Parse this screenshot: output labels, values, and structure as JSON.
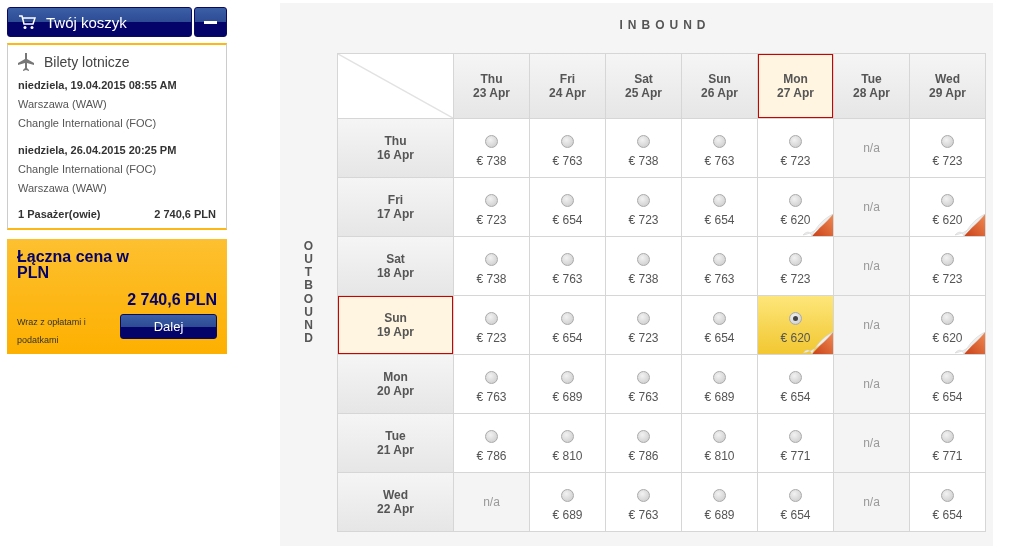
{
  "cart": {
    "title": "Twój koszyk",
    "section_title": "Bilety lotnicze",
    "flights": [
      {
        "date": "niedziela, 19.04.2015 08:55 AM",
        "from": "Warszawa (WAW)",
        "to": "Changle International (FOC)"
      },
      {
        "date": "niedziela, 26.04.2015 20:25 PM",
        "from": "Changle International (FOC)",
        "to": "Warszawa (WAW)"
      }
    ],
    "passengers": "1 Pasażer(owie)",
    "subtotal": "2 740,6 PLN"
  },
  "total": {
    "label": "Łączna cena w PLN",
    "amount": "2 740,6 PLN",
    "note": "Wraz z opłatami i podatkami",
    "button": "Dalej"
  },
  "matrix": {
    "inbound_label": "INBOUND",
    "outbound_label": "OUTBOUND",
    "columns": [
      {
        "day": "Thu",
        "date": "23 Apr",
        "selected": false
      },
      {
        "day": "Fri",
        "date": "24 Apr",
        "selected": false
      },
      {
        "day": "Sat",
        "date": "25 Apr",
        "selected": false
      },
      {
        "day": "Sun",
        "date": "26 Apr",
        "selected": false
      },
      {
        "day": "Mon",
        "date": "27 Apr",
        "selected": true
      },
      {
        "day": "Tue",
        "date": "28 Apr",
        "selected": false
      },
      {
        "day": "Wed",
        "date": "29 Apr",
        "selected": false
      }
    ],
    "rows": [
      {
        "day": "Thu",
        "date": "16 Apr",
        "selected": false,
        "cells": [
          {
            "kind": "fare",
            "price": "€ 738",
            "selected": false,
            "deal": false
          },
          {
            "kind": "fare",
            "price": "€ 763",
            "selected": false,
            "deal": false
          },
          {
            "kind": "fare",
            "price": "€ 738",
            "selected": false,
            "deal": false
          },
          {
            "kind": "fare",
            "price": "€ 763",
            "selected": false,
            "deal": false
          },
          {
            "kind": "fare",
            "price": "€ 723",
            "selected": false,
            "deal": false
          },
          {
            "kind": "na",
            "text": "n/a"
          },
          {
            "kind": "fare",
            "price": "€ 723",
            "selected": false,
            "deal": false
          }
        ]
      },
      {
        "day": "Fri",
        "date": "17 Apr",
        "selected": false,
        "cells": [
          {
            "kind": "fare",
            "price": "€ 723",
            "selected": false,
            "deal": false
          },
          {
            "kind": "fare",
            "price": "€ 654",
            "selected": false,
            "deal": false
          },
          {
            "kind": "fare",
            "price": "€ 723",
            "selected": false,
            "deal": false
          },
          {
            "kind": "fare",
            "price": "€ 654",
            "selected": false,
            "deal": false
          },
          {
            "kind": "fare",
            "price": "€ 620",
            "selected": false,
            "deal": true
          },
          {
            "kind": "na",
            "text": "n/a"
          },
          {
            "kind": "fare",
            "price": "€ 620",
            "selected": false,
            "deal": true
          }
        ]
      },
      {
        "day": "Sat",
        "date": "18 Apr",
        "selected": false,
        "cells": [
          {
            "kind": "fare",
            "price": "€ 738",
            "selected": false,
            "deal": false
          },
          {
            "kind": "fare",
            "price": "€ 763",
            "selected": false,
            "deal": false
          },
          {
            "kind": "fare",
            "price": "€ 738",
            "selected": false,
            "deal": false
          },
          {
            "kind": "fare",
            "price": "€ 763",
            "selected": false,
            "deal": false
          },
          {
            "kind": "fare",
            "price": "€ 723",
            "selected": false,
            "deal": false
          },
          {
            "kind": "na",
            "text": "n/a"
          },
          {
            "kind": "fare",
            "price": "€ 723",
            "selected": false,
            "deal": false
          }
        ]
      },
      {
        "day": "Sun",
        "date": "19 Apr",
        "selected": true,
        "cells": [
          {
            "kind": "fare",
            "price": "€ 723",
            "selected": false,
            "deal": false
          },
          {
            "kind": "fare",
            "price": "€ 654",
            "selected": false,
            "deal": false
          },
          {
            "kind": "fare",
            "price": "€ 723",
            "selected": false,
            "deal": false
          },
          {
            "kind": "fare",
            "price": "€ 654",
            "selected": false,
            "deal": false
          },
          {
            "kind": "fare",
            "price": "€ 620",
            "selected": true,
            "deal": true
          },
          {
            "kind": "na",
            "text": "n/a"
          },
          {
            "kind": "fare",
            "price": "€ 620",
            "selected": false,
            "deal": true
          }
        ]
      },
      {
        "day": "Mon",
        "date": "20 Apr",
        "selected": false,
        "cells": [
          {
            "kind": "fare",
            "price": "€ 763",
            "selected": false,
            "deal": false
          },
          {
            "kind": "fare",
            "price": "€ 689",
            "selected": false,
            "deal": false
          },
          {
            "kind": "fare",
            "price": "€ 763",
            "selected": false,
            "deal": false
          },
          {
            "kind": "fare",
            "price": "€ 689",
            "selected": false,
            "deal": false
          },
          {
            "kind": "fare",
            "price": "€ 654",
            "selected": false,
            "deal": false
          },
          {
            "kind": "na",
            "text": "n/a"
          },
          {
            "kind": "fare",
            "price": "€ 654",
            "selected": false,
            "deal": false
          }
        ]
      },
      {
        "day": "Tue",
        "date": "21 Apr",
        "selected": false,
        "cells": [
          {
            "kind": "fare",
            "price": "€ 786",
            "selected": false,
            "deal": false
          },
          {
            "kind": "fare",
            "price": "€ 810",
            "selected": false,
            "deal": false
          },
          {
            "kind": "fare",
            "price": "€ 786",
            "selected": false,
            "deal": false
          },
          {
            "kind": "fare",
            "price": "€ 810",
            "selected": false,
            "deal": false
          },
          {
            "kind": "fare",
            "price": "€ 771",
            "selected": false,
            "deal": false
          },
          {
            "kind": "na",
            "text": "n/a"
          },
          {
            "kind": "fare",
            "price": "€ 771",
            "selected": false,
            "deal": false
          }
        ]
      },
      {
        "day": "Wed",
        "date": "22 Apr",
        "selected": false,
        "cells": [
          {
            "kind": "na",
            "text": "n/a"
          },
          {
            "kind": "fare",
            "price": "€ 689",
            "selected": false,
            "deal": false
          },
          {
            "kind": "fare",
            "price": "€ 763",
            "selected": false,
            "deal": false
          },
          {
            "kind": "fare",
            "price": "€ 689",
            "selected": false,
            "deal": false
          },
          {
            "kind": "fare",
            "price": "€ 654",
            "selected": false,
            "deal": false
          },
          {
            "kind": "na",
            "text": "n/a"
          },
          {
            "kind": "fare",
            "price": "€ 654",
            "selected": false,
            "deal": false
          }
        ]
      }
    ]
  }
}
